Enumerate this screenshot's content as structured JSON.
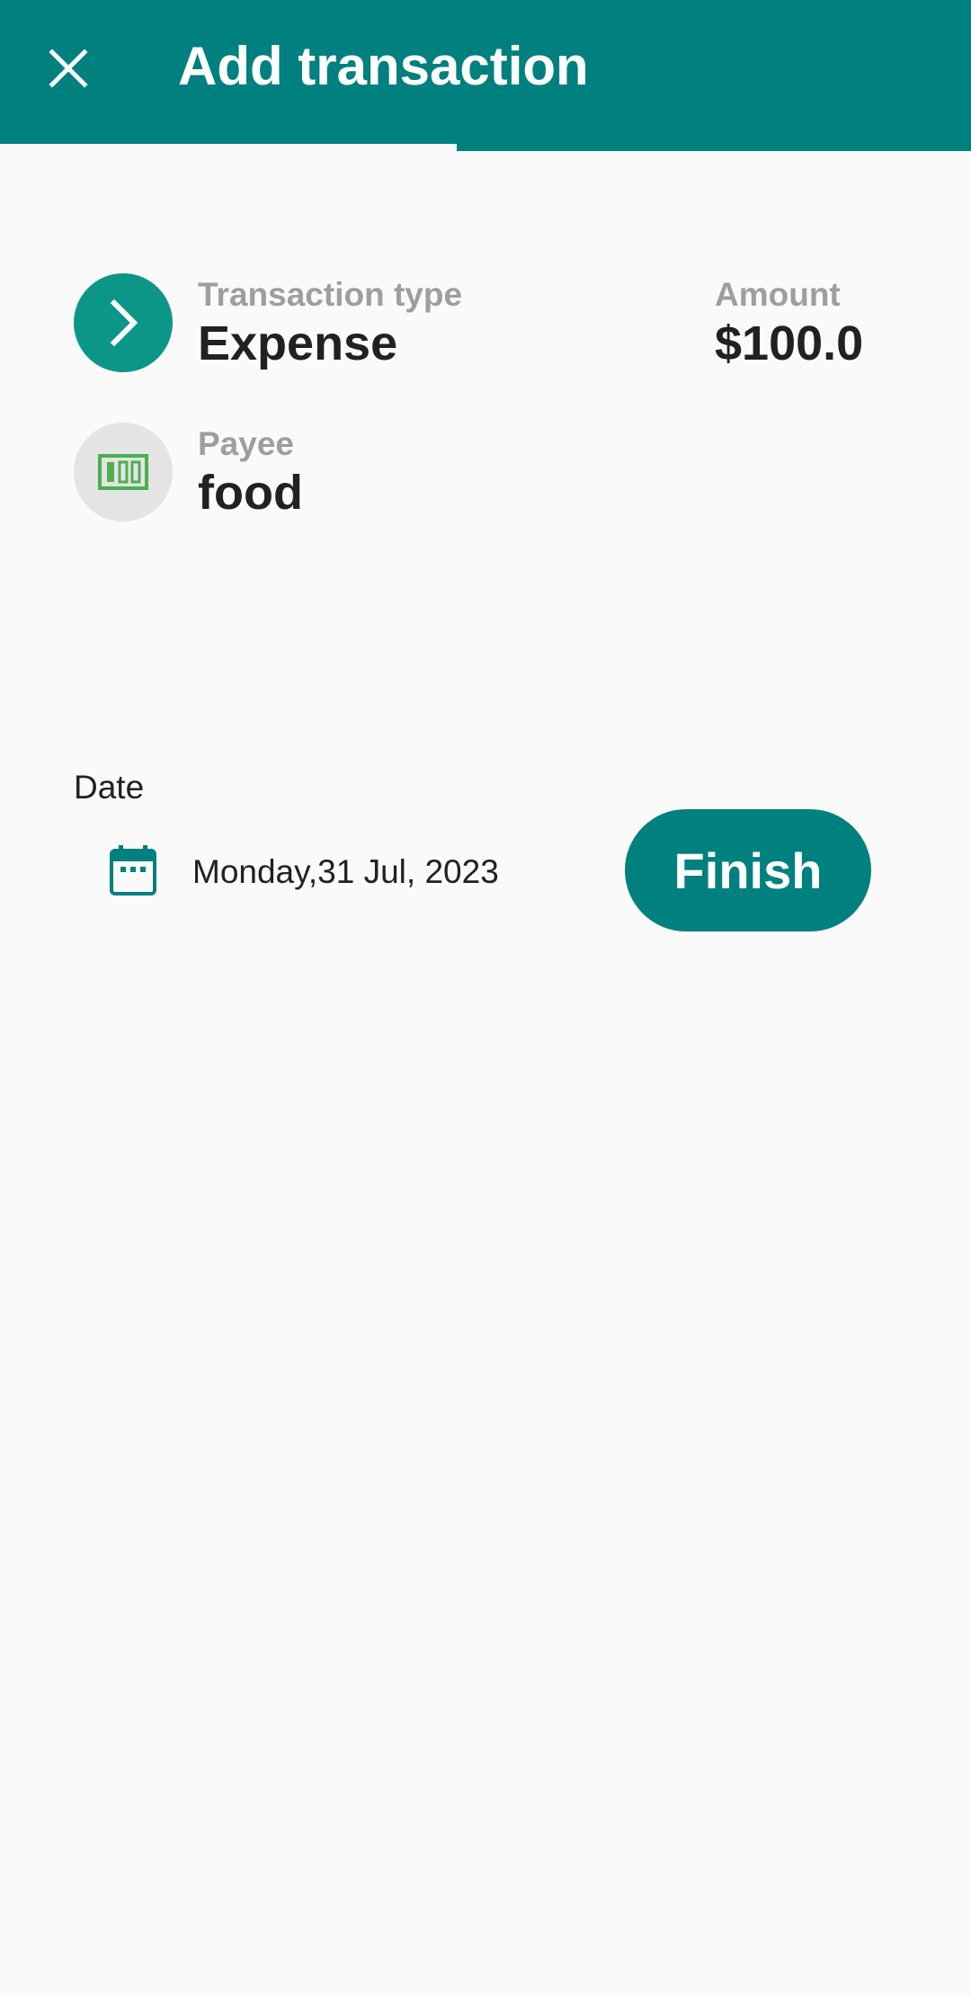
{
  "appbar": {
    "title": "Add transaction",
    "close_icon": "close-icon",
    "background": "#00807f"
  },
  "progress": {
    "value": 0.47
  },
  "transaction_type": {
    "label": "Transaction type",
    "value": "Expense",
    "icon": "chevron-right-icon",
    "icon_bg": "#0b9688"
  },
  "amount": {
    "label": "Amount",
    "value": "$100.0"
  },
  "payee": {
    "label": "Payee",
    "value": "food",
    "icon": "money-icon",
    "icon_color": "#4caf50"
  },
  "date": {
    "label": "Date",
    "value": "Monday,31 Jul, 2023",
    "icon": "calendar-icon"
  },
  "finish_button": {
    "label": "Finish"
  }
}
